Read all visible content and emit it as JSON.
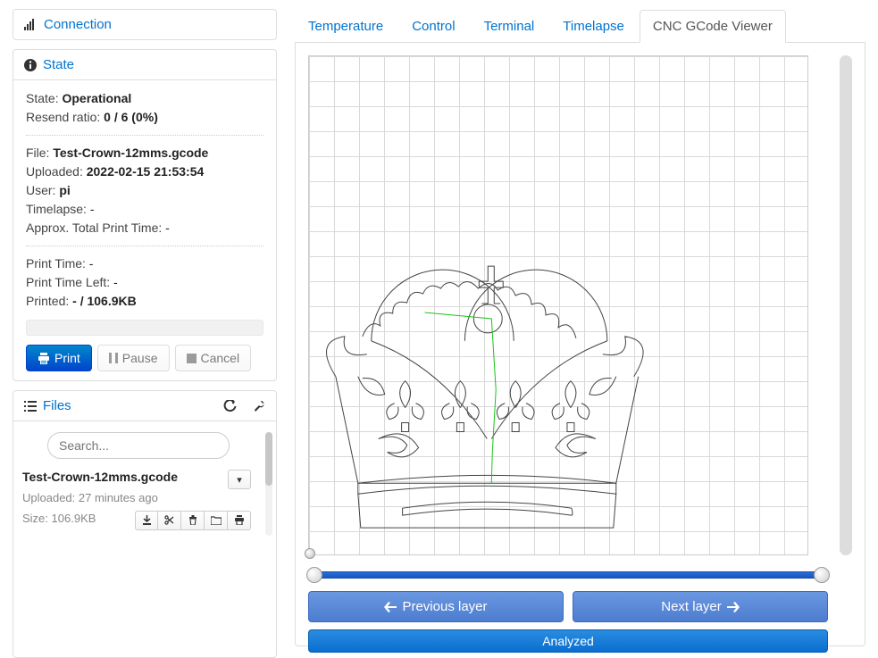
{
  "sidebar": {
    "connection": {
      "title": "Connection"
    },
    "state": {
      "title": "State",
      "labels": {
        "state": "State:",
        "resend": "Resend ratio:",
        "file": "File:",
        "uploaded": "Uploaded:",
        "user": "User:",
        "timelapse": "Timelapse:",
        "approx": "Approx. Total Print Time:",
        "printtime": "Print Time:",
        "printtimeleft": "Print Time Left:",
        "printed": "Printed:"
      },
      "values": {
        "state": "Operational",
        "resend": "0 / 6 (0%)",
        "file": "Test-Crown-12mms.gcode",
        "uploaded": "2022-02-15 21:53:54",
        "user": "pi",
        "timelapse": "-",
        "approx": "-",
        "printtime": "-",
        "printtimeleft": "-",
        "printed": "- / 106.9KB"
      },
      "buttons": {
        "print": "Print",
        "pause": "Pause",
        "cancel": "Cancel"
      }
    },
    "files": {
      "title": "Files",
      "search_placeholder": "Search...",
      "entry": {
        "name": "Test-Crown-12mms.gcode",
        "uploaded_label": "Uploaded:",
        "uploaded_value": "27 minutes ago",
        "size_label": "Size:",
        "size_value": "106.9KB"
      }
    }
  },
  "tabs": [
    {
      "label": "Temperature"
    },
    {
      "label": "Control"
    },
    {
      "label": "Terminal"
    },
    {
      "label": "Timelapse"
    },
    {
      "label": "CNC GCode Viewer",
      "active": true
    }
  ],
  "viewer": {
    "prev_layer": "Previous layer",
    "next_layer": "Next layer",
    "analyzed": "Analyzed"
  }
}
